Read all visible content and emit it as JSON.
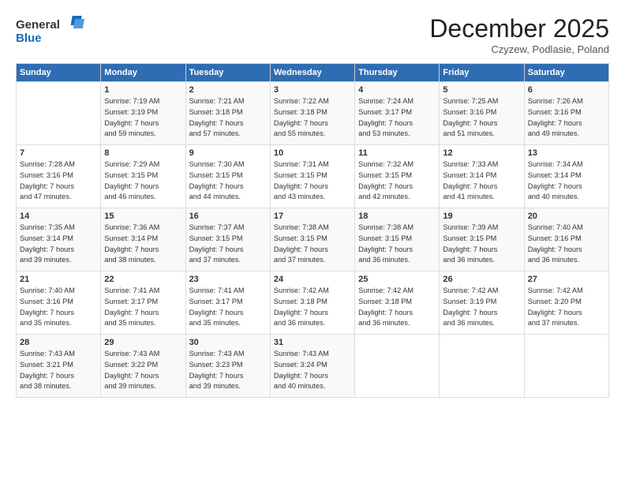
{
  "logo": {
    "general": "General",
    "blue": "Blue"
  },
  "header": {
    "month": "December 2025",
    "location": "Czyzew, Podlasie, Poland"
  },
  "days_of_week": [
    "Sunday",
    "Monday",
    "Tuesday",
    "Wednesday",
    "Thursday",
    "Friday",
    "Saturday"
  ],
  "weeks": [
    [
      {
        "day": null
      },
      {
        "day": 1,
        "sunrise": "Sunrise: 7:19 AM",
        "sunset": "Sunset: 3:19 PM",
        "daylight": "Daylight: 7 hours",
        "minutes": "and 59 minutes."
      },
      {
        "day": 2,
        "sunrise": "Sunrise: 7:21 AM",
        "sunset": "Sunset: 3:18 PM",
        "daylight": "Daylight: 7 hours",
        "minutes": "and 57 minutes."
      },
      {
        "day": 3,
        "sunrise": "Sunrise: 7:22 AM",
        "sunset": "Sunset: 3:18 PM",
        "daylight": "Daylight: 7 hours",
        "minutes": "and 55 minutes."
      },
      {
        "day": 4,
        "sunrise": "Sunrise: 7:24 AM",
        "sunset": "Sunset: 3:17 PM",
        "daylight": "Daylight: 7 hours",
        "minutes": "and 53 minutes."
      },
      {
        "day": 5,
        "sunrise": "Sunrise: 7:25 AM",
        "sunset": "Sunset: 3:16 PM",
        "daylight": "Daylight: 7 hours",
        "minutes": "and 51 minutes."
      },
      {
        "day": 6,
        "sunrise": "Sunrise: 7:26 AM",
        "sunset": "Sunset: 3:16 PM",
        "daylight": "Daylight: 7 hours",
        "minutes": "and 49 minutes."
      }
    ],
    [
      {
        "day": 7,
        "sunrise": "Sunrise: 7:28 AM",
        "sunset": "Sunset: 3:16 PM",
        "daylight": "Daylight: 7 hours",
        "minutes": "and 47 minutes."
      },
      {
        "day": 8,
        "sunrise": "Sunrise: 7:29 AM",
        "sunset": "Sunset: 3:15 PM",
        "daylight": "Daylight: 7 hours",
        "minutes": "and 46 minutes."
      },
      {
        "day": 9,
        "sunrise": "Sunrise: 7:30 AM",
        "sunset": "Sunset: 3:15 PM",
        "daylight": "Daylight: 7 hours",
        "minutes": "and 44 minutes."
      },
      {
        "day": 10,
        "sunrise": "Sunrise: 7:31 AM",
        "sunset": "Sunset: 3:15 PM",
        "daylight": "Daylight: 7 hours",
        "minutes": "and 43 minutes."
      },
      {
        "day": 11,
        "sunrise": "Sunrise: 7:32 AM",
        "sunset": "Sunset: 3:15 PM",
        "daylight": "Daylight: 7 hours",
        "minutes": "and 42 minutes."
      },
      {
        "day": 12,
        "sunrise": "Sunrise: 7:33 AM",
        "sunset": "Sunset: 3:14 PM",
        "daylight": "Daylight: 7 hours",
        "minutes": "and 41 minutes."
      },
      {
        "day": 13,
        "sunrise": "Sunrise: 7:34 AM",
        "sunset": "Sunset: 3:14 PM",
        "daylight": "Daylight: 7 hours",
        "minutes": "and 40 minutes."
      }
    ],
    [
      {
        "day": 14,
        "sunrise": "Sunrise: 7:35 AM",
        "sunset": "Sunset: 3:14 PM",
        "daylight": "Daylight: 7 hours",
        "minutes": "and 39 minutes."
      },
      {
        "day": 15,
        "sunrise": "Sunrise: 7:36 AM",
        "sunset": "Sunset: 3:14 PM",
        "daylight": "Daylight: 7 hours",
        "minutes": "and 38 minutes."
      },
      {
        "day": 16,
        "sunrise": "Sunrise: 7:37 AM",
        "sunset": "Sunset: 3:15 PM",
        "daylight": "Daylight: 7 hours",
        "minutes": "and 37 minutes."
      },
      {
        "day": 17,
        "sunrise": "Sunrise: 7:38 AM",
        "sunset": "Sunset: 3:15 PM",
        "daylight": "Daylight: 7 hours",
        "minutes": "and 37 minutes."
      },
      {
        "day": 18,
        "sunrise": "Sunrise: 7:38 AM",
        "sunset": "Sunset: 3:15 PM",
        "daylight": "Daylight: 7 hours",
        "minutes": "and 36 minutes."
      },
      {
        "day": 19,
        "sunrise": "Sunrise: 7:39 AM",
        "sunset": "Sunset: 3:15 PM",
        "daylight": "Daylight: 7 hours",
        "minutes": "and 36 minutes."
      },
      {
        "day": 20,
        "sunrise": "Sunrise: 7:40 AM",
        "sunset": "Sunset: 3:16 PM",
        "daylight": "Daylight: 7 hours",
        "minutes": "and 36 minutes."
      }
    ],
    [
      {
        "day": 21,
        "sunrise": "Sunrise: 7:40 AM",
        "sunset": "Sunset: 3:16 PM",
        "daylight": "Daylight: 7 hours",
        "minutes": "and 35 minutes."
      },
      {
        "day": 22,
        "sunrise": "Sunrise: 7:41 AM",
        "sunset": "Sunset: 3:17 PM",
        "daylight": "Daylight: 7 hours",
        "minutes": "and 35 minutes."
      },
      {
        "day": 23,
        "sunrise": "Sunrise: 7:41 AM",
        "sunset": "Sunset: 3:17 PM",
        "daylight": "Daylight: 7 hours",
        "minutes": "and 35 minutes."
      },
      {
        "day": 24,
        "sunrise": "Sunrise: 7:42 AM",
        "sunset": "Sunset: 3:18 PM",
        "daylight": "Daylight: 7 hours",
        "minutes": "and 36 minutes."
      },
      {
        "day": 25,
        "sunrise": "Sunrise: 7:42 AM",
        "sunset": "Sunset: 3:18 PM",
        "daylight": "Daylight: 7 hours",
        "minutes": "and 36 minutes."
      },
      {
        "day": 26,
        "sunrise": "Sunrise: 7:42 AM",
        "sunset": "Sunset: 3:19 PM",
        "daylight": "Daylight: 7 hours",
        "minutes": "and 36 minutes."
      },
      {
        "day": 27,
        "sunrise": "Sunrise: 7:42 AM",
        "sunset": "Sunset: 3:20 PM",
        "daylight": "Daylight: 7 hours",
        "minutes": "and 37 minutes."
      }
    ],
    [
      {
        "day": 28,
        "sunrise": "Sunrise: 7:43 AM",
        "sunset": "Sunset: 3:21 PM",
        "daylight": "Daylight: 7 hours",
        "minutes": "and 38 minutes."
      },
      {
        "day": 29,
        "sunrise": "Sunrise: 7:43 AM",
        "sunset": "Sunset: 3:22 PM",
        "daylight": "Daylight: 7 hours",
        "minutes": "and 39 minutes."
      },
      {
        "day": 30,
        "sunrise": "Sunrise: 7:43 AM",
        "sunset": "Sunset: 3:23 PM",
        "daylight": "Daylight: 7 hours",
        "minutes": "and 39 minutes."
      },
      {
        "day": 31,
        "sunrise": "Sunrise: 7:43 AM",
        "sunset": "Sunset: 3:24 PM",
        "daylight": "Daylight: 7 hours",
        "minutes": "and 40 minutes."
      },
      {
        "day": null
      },
      {
        "day": null
      },
      {
        "day": null
      }
    ]
  ]
}
